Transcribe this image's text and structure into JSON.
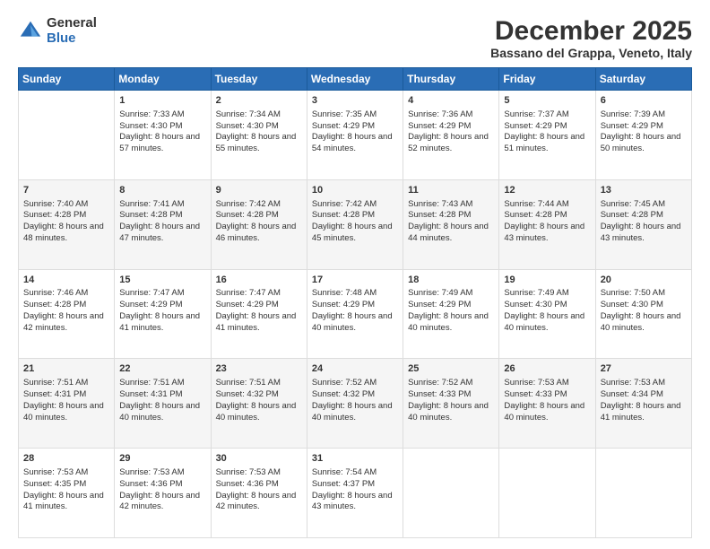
{
  "logo": {
    "general": "General",
    "blue": "Blue"
  },
  "header": {
    "month": "December 2025",
    "location": "Bassano del Grappa, Veneto, Italy"
  },
  "days": [
    "Sunday",
    "Monday",
    "Tuesday",
    "Wednesday",
    "Thursday",
    "Friday",
    "Saturday"
  ],
  "weeks": [
    [
      {
        "day": "",
        "sunrise": "",
        "sunset": "",
        "daylight": ""
      },
      {
        "day": "1",
        "sunrise": "Sunrise: 7:33 AM",
        "sunset": "Sunset: 4:30 PM",
        "daylight": "Daylight: 8 hours and 57 minutes."
      },
      {
        "day": "2",
        "sunrise": "Sunrise: 7:34 AM",
        "sunset": "Sunset: 4:30 PM",
        "daylight": "Daylight: 8 hours and 55 minutes."
      },
      {
        "day": "3",
        "sunrise": "Sunrise: 7:35 AM",
        "sunset": "Sunset: 4:29 PM",
        "daylight": "Daylight: 8 hours and 54 minutes."
      },
      {
        "day": "4",
        "sunrise": "Sunrise: 7:36 AM",
        "sunset": "Sunset: 4:29 PM",
        "daylight": "Daylight: 8 hours and 52 minutes."
      },
      {
        "day": "5",
        "sunrise": "Sunrise: 7:37 AM",
        "sunset": "Sunset: 4:29 PM",
        "daylight": "Daylight: 8 hours and 51 minutes."
      },
      {
        "day": "6",
        "sunrise": "Sunrise: 7:39 AM",
        "sunset": "Sunset: 4:29 PM",
        "daylight": "Daylight: 8 hours and 50 minutes."
      }
    ],
    [
      {
        "day": "7",
        "sunrise": "Sunrise: 7:40 AM",
        "sunset": "Sunset: 4:28 PM",
        "daylight": "Daylight: 8 hours and 48 minutes."
      },
      {
        "day": "8",
        "sunrise": "Sunrise: 7:41 AM",
        "sunset": "Sunset: 4:28 PM",
        "daylight": "Daylight: 8 hours and 47 minutes."
      },
      {
        "day": "9",
        "sunrise": "Sunrise: 7:42 AM",
        "sunset": "Sunset: 4:28 PM",
        "daylight": "Daylight: 8 hours and 46 minutes."
      },
      {
        "day": "10",
        "sunrise": "Sunrise: 7:42 AM",
        "sunset": "Sunset: 4:28 PM",
        "daylight": "Daylight: 8 hours and 45 minutes."
      },
      {
        "day": "11",
        "sunrise": "Sunrise: 7:43 AM",
        "sunset": "Sunset: 4:28 PM",
        "daylight": "Daylight: 8 hours and 44 minutes."
      },
      {
        "day": "12",
        "sunrise": "Sunrise: 7:44 AM",
        "sunset": "Sunset: 4:28 PM",
        "daylight": "Daylight: 8 hours and 43 minutes."
      },
      {
        "day": "13",
        "sunrise": "Sunrise: 7:45 AM",
        "sunset": "Sunset: 4:28 PM",
        "daylight": "Daylight: 8 hours and 43 minutes."
      }
    ],
    [
      {
        "day": "14",
        "sunrise": "Sunrise: 7:46 AM",
        "sunset": "Sunset: 4:28 PM",
        "daylight": "Daylight: 8 hours and 42 minutes."
      },
      {
        "day": "15",
        "sunrise": "Sunrise: 7:47 AM",
        "sunset": "Sunset: 4:29 PM",
        "daylight": "Daylight: 8 hours and 41 minutes."
      },
      {
        "day": "16",
        "sunrise": "Sunrise: 7:47 AM",
        "sunset": "Sunset: 4:29 PM",
        "daylight": "Daylight: 8 hours and 41 minutes."
      },
      {
        "day": "17",
        "sunrise": "Sunrise: 7:48 AM",
        "sunset": "Sunset: 4:29 PM",
        "daylight": "Daylight: 8 hours and 40 minutes."
      },
      {
        "day": "18",
        "sunrise": "Sunrise: 7:49 AM",
        "sunset": "Sunset: 4:29 PM",
        "daylight": "Daylight: 8 hours and 40 minutes."
      },
      {
        "day": "19",
        "sunrise": "Sunrise: 7:49 AM",
        "sunset": "Sunset: 4:30 PM",
        "daylight": "Daylight: 8 hours and 40 minutes."
      },
      {
        "day": "20",
        "sunrise": "Sunrise: 7:50 AM",
        "sunset": "Sunset: 4:30 PM",
        "daylight": "Daylight: 8 hours and 40 minutes."
      }
    ],
    [
      {
        "day": "21",
        "sunrise": "Sunrise: 7:51 AM",
        "sunset": "Sunset: 4:31 PM",
        "daylight": "Daylight: 8 hours and 40 minutes."
      },
      {
        "day": "22",
        "sunrise": "Sunrise: 7:51 AM",
        "sunset": "Sunset: 4:31 PM",
        "daylight": "Daylight: 8 hours and 40 minutes."
      },
      {
        "day": "23",
        "sunrise": "Sunrise: 7:51 AM",
        "sunset": "Sunset: 4:32 PM",
        "daylight": "Daylight: 8 hours and 40 minutes."
      },
      {
        "day": "24",
        "sunrise": "Sunrise: 7:52 AM",
        "sunset": "Sunset: 4:32 PM",
        "daylight": "Daylight: 8 hours and 40 minutes."
      },
      {
        "day": "25",
        "sunrise": "Sunrise: 7:52 AM",
        "sunset": "Sunset: 4:33 PM",
        "daylight": "Daylight: 8 hours and 40 minutes."
      },
      {
        "day": "26",
        "sunrise": "Sunrise: 7:53 AM",
        "sunset": "Sunset: 4:33 PM",
        "daylight": "Daylight: 8 hours and 40 minutes."
      },
      {
        "day": "27",
        "sunrise": "Sunrise: 7:53 AM",
        "sunset": "Sunset: 4:34 PM",
        "daylight": "Daylight: 8 hours and 41 minutes."
      }
    ],
    [
      {
        "day": "28",
        "sunrise": "Sunrise: 7:53 AM",
        "sunset": "Sunset: 4:35 PM",
        "daylight": "Daylight: 8 hours and 41 minutes."
      },
      {
        "day": "29",
        "sunrise": "Sunrise: 7:53 AM",
        "sunset": "Sunset: 4:36 PM",
        "daylight": "Daylight: 8 hours and 42 minutes."
      },
      {
        "day": "30",
        "sunrise": "Sunrise: 7:53 AM",
        "sunset": "Sunset: 4:36 PM",
        "daylight": "Daylight: 8 hours and 42 minutes."
      },
      {
        "day": "31",
        "sunrise": "Sunrise: 7:54 AM",
        "sunset": "Sunset: 4:37 PM",
        "daylight": "Daylight: 8 hours and 43 minutes."
      },
      {
        "day": "",
        "sunrise": "",
        "sunset": "",
        "daylight": ""
      },
      {
        "day": "",
        "sunrise": "",
        "sunset": "",
        "daylight": ""
      },
      {
        "day": "",
        "sunrise": "",
        "sunset": "",
        "daylight": ""
      }
    ]
  ]
}
